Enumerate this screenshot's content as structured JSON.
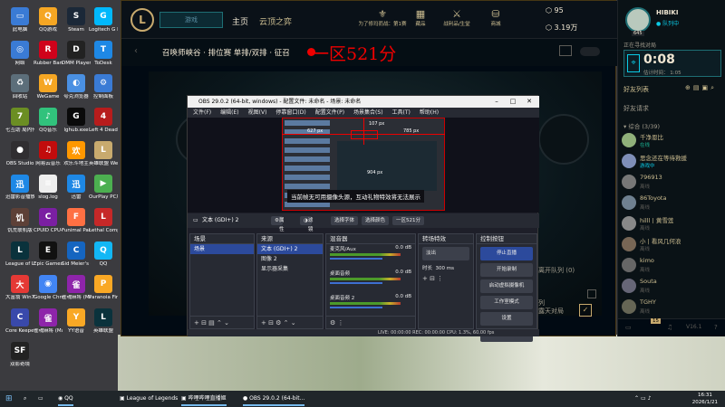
{
  "desktop": {
    "icons": [
      {
        "label": "此电脑",
        "glyph": "▭",
        "color": "#3a7bd5"
      },
      {
        "label": "QQ游戏",
        "glyph": "Q",
        "color": "#f5a623"
      },
      {
        "label": "Steam",
        "glyph": "S",
        "color": "#1b2838"
      },
      {
        "label": "Logitech G HUB",
        "glyph": "G",
        "color": "#00b8fc"
      },
      {
        "label": "网络",
        "glyph": "◎",
        "color": "#3a7bd5"
      },
      {
        "label": "Rubber Bandits",
        "glyph": "R",
        "color": "#d0021b"
      },
      {
        "label": "DMM Player v2",
        "glyph": "D",
        "color": "#222"
      },
      {
        "label": "ToDesk",
        "glyph": "T",
        "color": "#1e88e5"
      },
      {
        "label": "回收站",
        "glyph": "♻",
        "color": "#5c6e7a"
      },
      {
        "label": "WeGame",
        "glyph": "W",
        "color": "#f5a623"
      },
      {
        "label": "夸克浏览器",
        "glyph": "◐",
        "color": "#4a90e2"
      },
      {
        "label": "控制面板",
        "glyph": "⚙",
        "color": "#3a7bd5"
      },
      {
        "label": "七互助 局内传送_ZERO",
        "glyph": "7",
        "color": "#6b8e23"
      },
      {
        "label": "QQ音乐",
        "glyph": "♪",
        "color": "#31c27c"
      },
      {
        "label": "lghub.exe",
        "glyph": "G",
        "color": "#0a0a0a"
      },
      {
        "label": "Left 4 Dead 2",
        "glyph": "4",
        "color": "#b71c1c"
      },
      {
        "label": "OBS Studio",
        "glyph": "●",
        "color": "#302e31"
      },
      {
        "label": "网易云音乐",
        "glyph": "♫",
        "color": "#c20c0c"
      },
      {
        "label": "欢乐斗地主",
        "glyph": "欢",
        "color": "#ff9800"
      },
      {
        "label": "英雄联盟 WeGame版",
        "glyph": "L",
        "color": "#c8aa6e"
      },
      {
        "label": "迅雷影音播放器",
        "glyph": "迅",
        "color": "#1e88e5"
      },
      {
        "label": "slog.log",
        "glyph": "≡",
        "color": "#eeeeee"
      },
      {
        "label": "迅雷",
        "glyph": "迅",
        "color": "#1e88e5"
      },
      {
        "label": "OurPlay PC版",
        "glyph": "▶",
        "color": "#4caf50"
      },
      {
        "label": "饥荒联机版",
        "glyph": "饥",
        "color": "#5d4037"
      },
      {
        "label": "CPUID CPU-Z",
        "glyph": "C",
        "color": "#7b1fa2"
      },
      {
        "label": "Funimal Party",
        "glyph": "F",
        "color": "#ff7043"
      },
      {
        "label": "Lethal Company",
        "glyph": "L",
        "color": "#c62828"
      },
      {
        "label": "League of Legends",
        "glyph": "L",
        "color": "#0a323c"
      },
      {
        "label": "Epic Games Launcher",
        "glyph": "E",
        "color": "#111"
      },
      {
        "label": "Sid Meier's Civilizatio",
        "glyph": "C",
        "color": "#1565c0"
      },
      {
        "label": "QQ",
        "glyph": "Q",
        "color": "#12b7f5"
      },
      {
        "label": "大富翁 Win7/Win",
        "glyph": "大",
        "color": "#e53935"
      },
      {
        "label": "Google Chrome",
        "glyph": "◉",
        "color": "#4285f4"
      },
      {
        "label": "雀魂麻将 (Mahjong...",
        "glyph": "雀",
        "color": "#8e24aa"
      },
      {
        "label": "Paranoia Fire & Te...",
        "glyph": "P",
        "color": "#f9a825"
      },
      {
        "label": "Core Keeper 饥...",
        "glyph": "C",
        "color": "#3949ab"
      },
      {
        "label": "雀魂麻将 (Mahjong...",
        "glyph": "雀",
        "color": "#8e24aa"
      },
      {
        "label": "YY语音",
        "glyph": "Y",
        "color": "#f9a825"
      },
      {
        "label": "英雄联盟",
        "glyph": "L",
        "color": "#0a323c"
      },
      {
        "label": "双影奇境",
        "glyph": "SF",
        "color": "#222"
      }
    ]
  },
  "lol": {
    "play_button": "游戏",
    "nav_home": "主页",
    "nav_tft": "云顶之弈",
    "rank_text": "为了修玛而战：第1赛",
    "tab_collection": "藏品",
    "tab_record": "战利品/生堂",
    "tab_shop": "商城",
    "currency_be": "95",
    "currency_rp": "3.19万",
    "mode_title": "召唤师峡谷 · 排位赛 单排/双排 · 征召",
    "red_overlay": "一区521分",
    "leave_hint": "离开队列 (0)",
    "lobby_side_label": "列",
    "lobby_side_sub": "露天对局",
    "player": {
      "name": "HIBIKI",
      "status": "队列中",
      "level": "645"
    },
    "queue_header": "正在寻找对局",
    "queue_timer": "0:08",
    "queue_estimate": "估计时间： 1:05",
    "friend_list_label": "好友列表",
    "friend_requests": "好友请求",
    "group_label": "▾ 综合 (3/39)",
    "friends": [
      {
        "name": "千净恩比",
        "status": "在线",
        "color": "#8fb07a",
        "online": true
      },
      {
        "name": "思念还在等待救援",
        "status": "游戏中",
        "color": "#7f8fb8",
        "online": true
      },
      {
        "name": "796913",
        "status": "离线",
        "color": "#777",
        "online": false
      },
      {
        "name": "86Toyota",
        "status": "离线",
        "color": "#6f8090",
        "online": false
      },
      {
        "name": "hilll丨黄雪莲",
        "status": "离线",
        "color": "#888",
        "online": false
      },
      {
        "name": "小 | 看风几何浪",
        "status": "离线",
        "color": "#776655",
        "online": false
      },
      {
        "name": "kimo",
        "status": "离线",
        "color": "#666",
        "online": false
      },
      {
        "name": "Souta",
        "status": "离线",
        "color": "#667",
        "online": false
      },
      {
        "name": "TGHY",
        "status": "离线",
        "color": "#665",
        "online": false
      }
    ],
    "bottom_count": "15",
    "version": "V16.1"
  },
  "obs": {
    "title": "OBS 29.0.2 (64-bit, windows) - 配置文件: 未命名 - 场景: 未命名",
    "menu": [
      "文件(F)",
      "编辑(E)",
      "视图(V)",
      "停靠窗口(D)",
      "配置文件(P)",
      "场景集合(S)",
      "工具(T)",
      "帮助(H)"
    ],
    "preview_labels": [
      "627 px",
      "107 px",
      "785 px",
      "904 px"
    ],
    "preview_notice": "当前帧无可用摄像头源，互动礼物特效将无法展示",
    "source_name": "文本 (GDI+) 2",
    "source_buttons": [
      "属性",
      "滤镜",
      "选择字体",
      "选择颜色",
      "一区521分"
    ],
    "scenes_title": "场景",
    "scenes": [
      "场景"
    ],
    "sources_title": "来源",
    "sources": [
      "文本 (GDI+) 2",
      "图像 2",
      "显示器采集"
    ],
    "mixer_title": "混音器",
    "mixer": [
      {
        "name": "麦克风/Aux",
        "db": "0.0 dB"
      },
      {
        "name": "桌面音频",
        "db": "0.0 dB"
      },
      {
        "name": "桌面音频 2",
        "db": "0.0 dB"
      }
    ],
    "transitions_title": "转场特效",
    "transition_select": "淡出",
    "transition_duration_label": "时长",
    "transition_duration": "300 ms",
    "controls_title": "控制按钮",
    "controls": [
      "停止直播",
      "开始录制",
      "启动虚拟摄像机",
      "工作室模式",
      "设置",
      "退出"
    ],
    "status": "LIVE: 00:00:00    REC: 00:00:00    CPU: 1.3%, 60.00 fps"
  },
  "taskbar": {
    "items": [
      "QQ",
      "League of Legends",
      "哔哩哔哩直播姬",
      "OBS 29.0.2 (64-bit..."
    ],
    "time": "16:31",
    "date": "2026/1/21"
  }
}
